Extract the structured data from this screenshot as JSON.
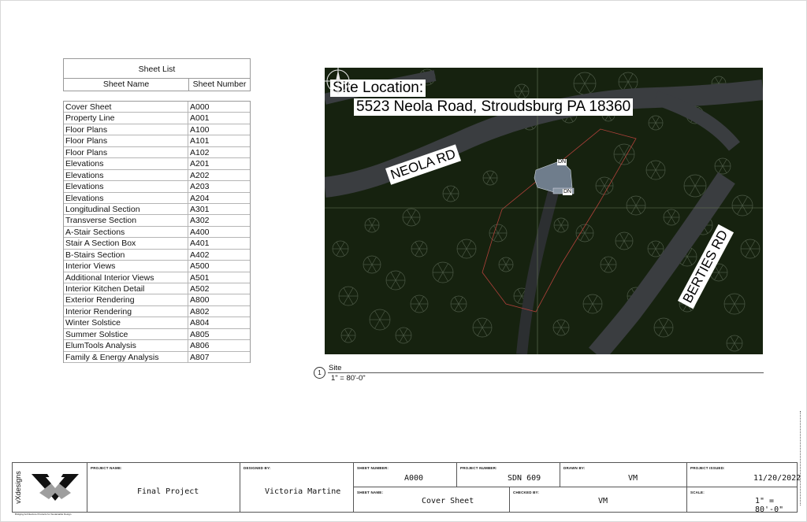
{
  "sheet_list": {
    "title": "Sheet List",
    "col_name": "Sheet Name",
    "col_number": "Sheet Number",
    "rows": [
      {
        "name": "Cover Sheet",
        "number": "A000"
      },
      {
        "name": "Property Line",
        "number": "A001"
      },
      {
        "name": "Floor Plans",
        "number": "A100"
      },
      {
        "name": "Floor Plans",
        "number": "A101"
      },
      {
        "name": "Floor Plans",
        "number": "A102"
      },
      {
        "name": "Elevations",
        "number": "A201"
      },
      {
        "name": "Elevations",
        "number": "A202"
      },
      {
        "name": "Elevations",
        "number": "A203"
      },
      {
        "name": "Elevations",
        "number": "A204"
      },
      {
        "name": "Longitudinal Section",
        "number": "A301"
      },
      {
        "name": "Transverse Section",
        "number": "A302"
      },
      {
        "name": "A-Stair Sections",
        "number": "A400"
      },
      {
        "name": "Stair A Section Box",
        "number": "A401"
      },
      {
        "name": "B-Stairs Section",
        "number": "A402"
      },
      {
        "name": "Interior Views",
        "number": "A500"
      },
      {
        "name": "Additional Interior Views",
        "number": "A501"
      },
      {
        "name": "Interior Kitchen Detail",
        "number": "A502"
      },
      {
        "name": "Exterior Rendering",
        "number": "A800"
      },
      {
        "name": "Interior Rendering",
        "number": "A802"
      },
      {
        "name": "Winter Solstice",
        "number": "A804"
      },
      {
        "name": "Summer Solstice",
        "number": "A805"
      },
      {
        "name": "ElumTools Analysis",
        "number": "A806"
      },
      {
        "name": "Family & Energy Analysis",
        "number": "A807"
      }
    ]
  },
  "site": {
    "location_label": "Site Location:",
    "address": "5523 Neola Road, Stroudsburg PA 18360",
    "road_1": "NEOLA RD",
    "road_2": "BERTIES RD",
    "dn_1": "DN",
    "dn_2": "DN",
    "view_number": "1",
    "view_name": "Site",
    "view_scale": "1\" = 80'-0\""
  },
  "title_block": {
    "company": "vXdesigns",
    "tagline": "Bridging Architecture Products for Sustainable Design",
    "project_name_label": "PROJECT NAME:",
    "project_name": "Final Project",
    "designed_by_label": "DESIGNED BY:",
    "designed_by": "Victoria Martine",
    "sheet_number_label": "SHEET NUMBER:",
    "sheet_number": "A000",
    "project_number_label": "PROJECT NUMBER:",
    "project_number": "SDN 609",
    "drawn_by_label": "DRAWN BY:",
    "drawn_by": "VM",
    "project_issued_label": "PROJECT ISSUED:",
    "project_issued": "11/20/2022",
    "sheet_name_label": "SHEET NAME:",
    "sheet_name": "Cover Sheet",
    "checked_by_label": "CHECKED BY:",
    "checked_by": "VM",
    "scale_label": "SCALE:",
    "scale": "1\" = 80'-0\""
  },
  "colors": {
    "map_background": "#16220f",
    "road": "#3a3d40",
    "property_line": "#b0413a",
    "building": "#6f7d8c"
  }
}
